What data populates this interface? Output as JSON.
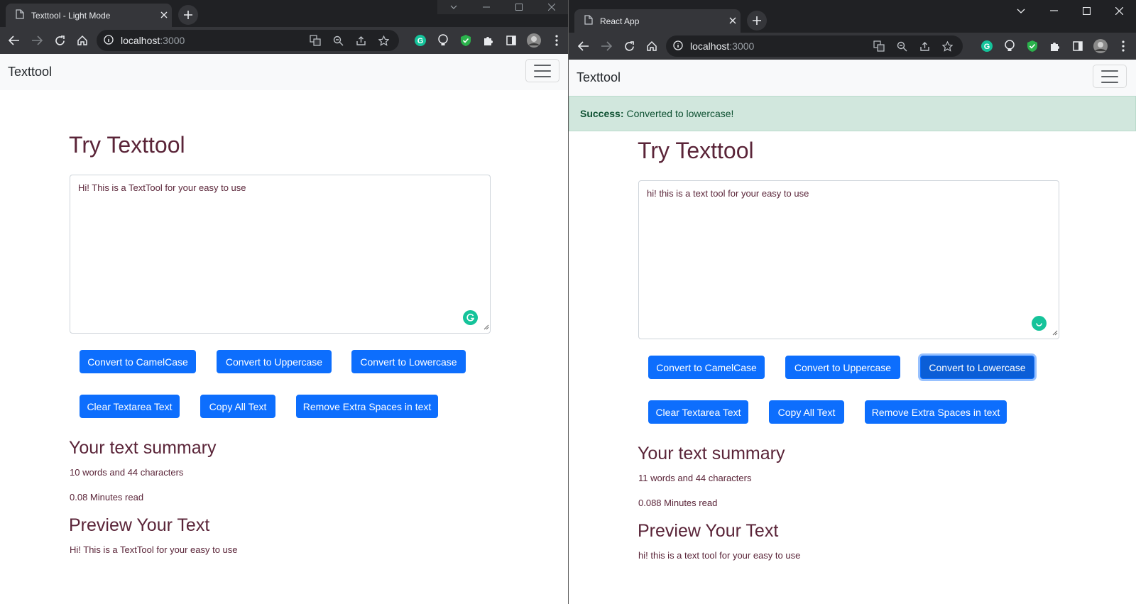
{
  "left": {
    "tab_title": "Texttool - Light Mode",
    "url_host": "localhost",
    "url_port": ":3000",
    "brand": "Texttool",
    "heading": "Try Texttool",
    "textarea_value": "Hi! This is a TextTool for your easy to use",
    "buttons": {
      "camel": "Convert to CamelCase",
      "upper": "Convert to Uppercase",
      "lower": "Convert to Lowercase",
      "clear": "Clear Textarea Text",
      "copy": "Copy All Text",
      "spaces": "Remove Extra Spaces in text"
    },
    "summary_heading": "Your text summary",
    "summary_counts": "10 words and 44 characters",
    "summary_read": "0.08 Minutes read",
    "preview_heading": "Preview Your Text",
    "preview_text": "Hi! This is a TextTool for your easy to use"
  },
  "right": {
    "tab_title": "React App",
    "url_host": "localhost",
    "url_port": ":3000",
    "brand": "Texttool",
    "alert_strong": "Success:",
    "alert_text": "Converted to lowercase!",
    "heading": "Try Texttool",
    "textarea_value": "hi! this is a text tool for your easy to use",
    "buttons": {
      "camel": "Convert to CamelCase",
      "upper": "Convert to Uppercase",
      "lower": "Convert to Lowercase",
      "clear": "Clear Textarea Text",
      "copy": "Copy All Text",
      "spaces": "Remove Extra Spaces in text"
    },
    "summary_heading": "Your text summary",
    "summary_counts": "11 words and 44 characters",
    "summary_read": "0.088 Minutes read",
    "preview_heading": "Preview Your Text",
    "preview_text": "hi! this is a text tool for your easy to use"
  },
  "colors": {
    "primary": "#0d6efd",
    "heading_text": "#5a2438",
    "alert_bg": "#d1e7dd",
    "alert_text": "#0f5132",
    "navbar_bg": "#f8f9fa",
    "chrome_frame": "#202124",
    "chrome_toolbar": "#35363a"
  },
  "icons": [
    "page-icon",
    "close-icon",
    "plus-icon",
    "back-arrow-icon",
    "forward-arrow-icon",
    "reload-icon",
    "home-icon",
    "info-icon",
    "translate-icon",
    "zoom-icon",
    "share-icon",
    "star-icon",
    "grammarly-icon",
    "lightbulb-icon",
    "shield-icon",
    "puzzle-icon",
    "sidepanel-icon",
    "profile-avatar",
    "kebab-menu-icon",
    "chevron-down-icon",
    "minimize-icon",
    "maximize-icon",
    "hamburger-icon"
  ]
}
